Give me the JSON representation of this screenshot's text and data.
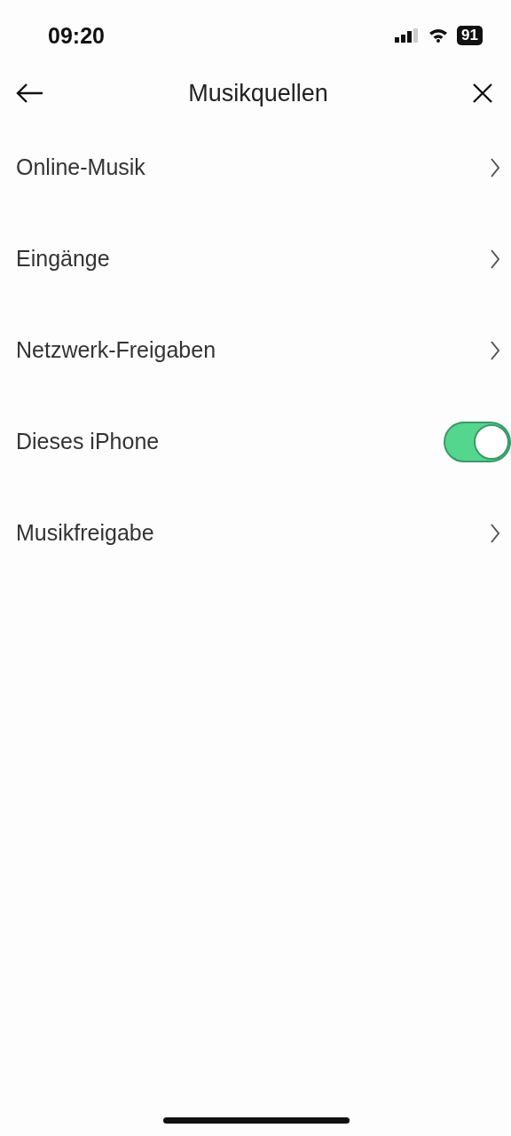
{
  "status_bar": {
    "time": "09:20",
    "battery": "91"
  },
  "header": {
    "title": "Musikquellen"
  },
  "items": [
    {
      "label": "Online-Musik",
      "kind": "link"
    },
    {
      "label": "Eingänge",
      "kind": "link"
    },
    {
      "label": "Netzwerk-Freigaben",
      "kind": "link"
    },
    {
      "label": "Dieses iPhone",
      "kind": "toggle",
      "on": true
    },
    {
      "label": "Musikfreigabe",
      "kind": "link"
    }
  ]
}
